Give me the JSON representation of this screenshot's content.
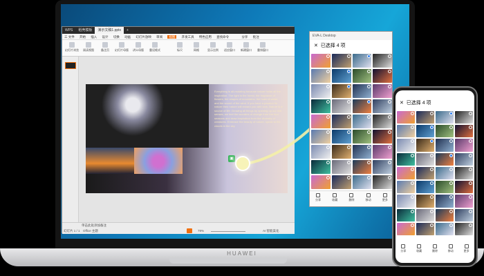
{
  "laptop": {
    "brand": "HUAWEI"
  },
  "wps": {
    "tabs": [
      "WPS",
      "稻壳模板",
      "演示文稿1.pptx"
    ],
    "menu": [
      "三 文件",
      "开始",
      "插入",
      "设计",
      "切换",
      "动画",
      "幻灯片放映",
      "审阅",
      "视图",
      "开发工具",
      "特色应用",
      "查找命令"
    ],
    "menu_right": [
      "分享",
      "批注"
    ],
    "toolbar": [
      "幻灯片浏览",
      "阅读视图",
      "备注页",
      "幻灯片母版",
      "讲义母版",
      "重设格式",
      "标尺",
      "网格",
      "显示比例",
      "适应窗口",
      "新建窗口",
      "重排窗口"
    ],
    "slide_text": "Everything is all-mutating because nature holds all the inspiration. The light in the forest, the fragrance of flowers, the shapes of mountains, the hues of water, and the sound of the wind. If you have a passion for nature then nature will reward you with love. Nature is a source of life. Growing all things by opening up our rich senses, we feel the wonders of change from the four seasons and draw inspiration from the diversity of creatures. Embrace the beauty of nature, speak to the clouds in the sky.",
    "notes": "单击此处添加备注",
    "status_left": "幻灯片 1 / 1",
    "status_theme": "Office 主题",
    "zoom": "79%",
    "ai": "AI 智能美化"
  },
  "mirror": {
    "title": "EVA-L Desktop",
    "header": "已选择 4 项",
    "bottom": [
      "分享",
      "收藏",
      "删除",
      "移动",
      "更多"
    ]
  },
  "phone": {
    "header": "已选择 4 项",
    "bottom": [
      "分享",
      "收藏",
      "删除",
      "移动",
      "更多"
    ]
  },
  "colors": {
    "accent": "#2a7cf0",
    "wps_orange": "#f07010",
    "drag": "#f7f3b8"
  }
}
